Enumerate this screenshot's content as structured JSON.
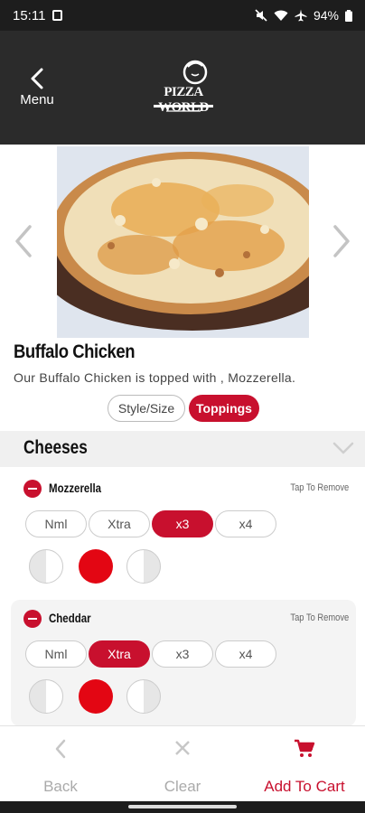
{
  "status_bar": {
    "time": "15:11",
    "battery": "94%"
  },
  "header": {
    "back_label": "Menu",
    "logo_text": "PIZZA WORLD"
  },
  "product": {
    "name": "Buffalo Chicken",
    "description": "Our Buffalo Chicken is topped with , Mozzerella."
  },
  "tabs": {
    "style_size": "Style/Size",
    "toppings": "Toppings",
    "active": "Toppings"
  },
  "section": {
    "title": "Cheeses"
  },
  "toppings": [
    {
      "name": "Mozzerella",
      "action": "Tap To Remove",
      "amounts": [
        "Nml",
        "Xtra",
        "x3",
        "x4"
      ],
      "selected_amount": "x3",
      "selected_side": "whole"
    },
    {
      "name": "Cheddar",
      "action": "Tap To Remove",
      "amounts": [
        "Nml",
        "Xtra",
        "x3",
        "x4"
      ],
      "selected_amount": "Xtra",
      "selected_side": "whole"
    }
  ],
  "bottom_bar": {
    "back": "Back",
    "clear": "Clear",
    "add_to_cart": "Add To Cart"
  },
  "colors": {
    "accent": "#c8102e",
    "header_bg": "#2b2b2b"
  },
  "icons": [
    "notification-icon",
    "mute-icon",
    "wifi-icon",
    "airplane-icon",
    "battery-icon",
    "chevron-left-icon",
    "chevron-right-icon",
    "chevron-down-icon",
    "close-icon",
    "cart-icon"
  ]
}
